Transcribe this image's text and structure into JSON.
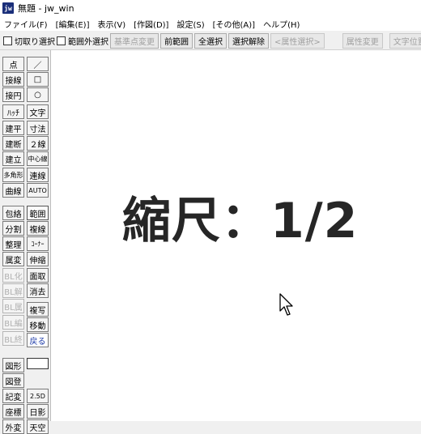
{
  "title_bar": {
    "icon_text": "jw",
    "title": "無題 - jw_win"
  },
  "menu": [
    "ファイル(F)",
    "[編集(E)]",
    "表示(V)",
    "[作図(D)]",
    "設定(S)",
    "[その他(A)]",
    "ヘルプ(H)"
  ],
  "toolbar": {
    "check1": "切取り選択",
    "check2": "範囲外選択",
    "buttons": [
      {
        "label": "基準点変更",
        "disabled": true
      },
      {
        "label": "前範囲",
        "disabled": false
      },
      {
        "label": "全選択",
        "disabled": false
      },
      {
        "label": "選択解除",
        "disabled": false
      },
      {
        "label": "<属性選択>",
        "disabled": true
      },
      {
        "label": "属性変更",
        "disabled": true
      },
      {
        "label": "文字位置",
        "disabled": true
      }
    ]
  },
  "left_col": [
    "点",
    "接線",
    "接円",
    "ﾊｯﾁ",
    "建平",
    "建断",
    "建立",
    "多角形",
    "曲線",
    "包絡",
    "分割",
    "整理",
    "属変",
    "BL化",
    "BL解",
    "BL属",
    "BL編",
    "BL終",
    "図形",
    "図登",
    "記変",
    "座標",
    "外変"
  ],
  "right_col": [
    "／",
    "□",
    "○",
    "文字",
    "寸法",
    "２線",
    "中心線",
    "連線",
    "AUTO",
    "範囲",
    "複線",
    "ｺｰﾅｰ",
    "伸縮",
    "面取",
    "消去",
    "複写",
    "移動",
    "戻る",
    "",
    "2.5D",
    "日影",
    "天空"
  ],
  "canvas_text": "縮尺：1/2"
}
